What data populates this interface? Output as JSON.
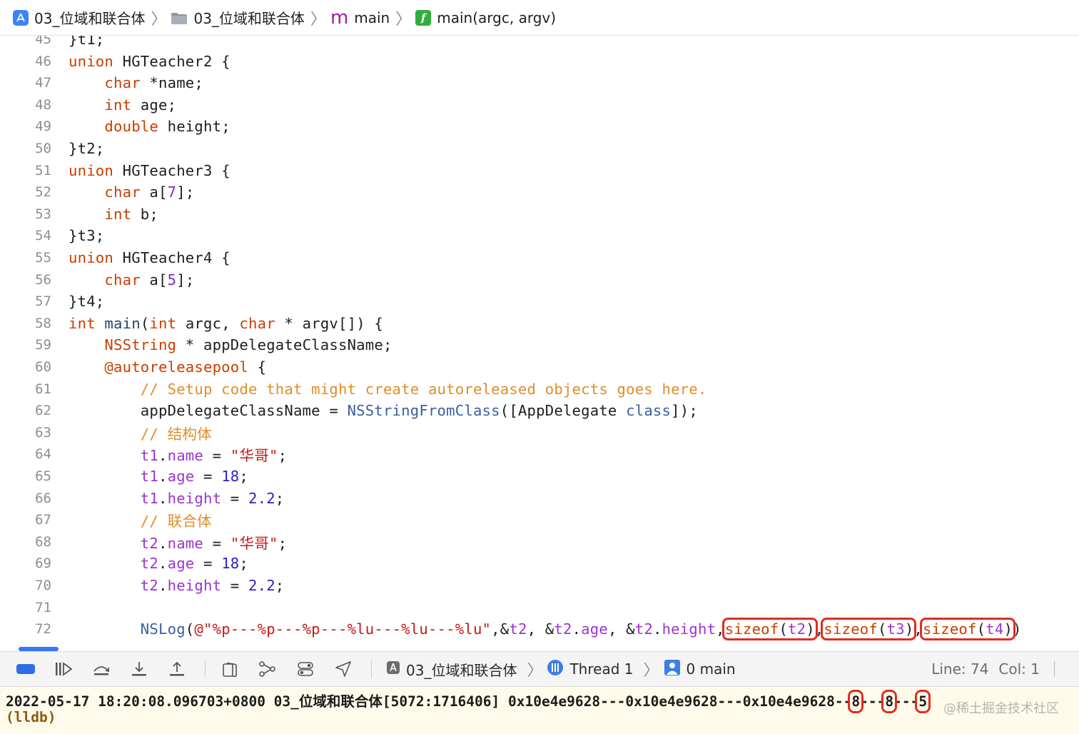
{
  "breadcrumb": {
    "project": "03_位域和联合体",
    "folder": "03_位域和联合体",
    "file": "main",
    "function": "main(argc, argv)"
  },
  "editor": {
    "lines": [
      {
        "num": "45",
        "code": "}t1;"
      },
      {
        "num": "46",
        "code": "union HGTeacher2 {"
      },
      {
        "num": "47",
        "code": "    char *name;"
      },
      {
        "num": "48",
        "code": "    int age;"
      },
      {
        "num": "49",
        "code": "    double height;"
      },
      {
        "num": "50",
        "code": "}t2;"
      },
      {
        "num": "51",
        "code": "union HGTeacher3 {"
      },
      {
        "num": "52",
        "code": "    char a[7];"
      },
      {
        "num": "53",
        "code": "    int b;"
      },
      {
        "num": "54",
        "code": "}t3;"
      },
      {
        "num": "55",
        "code": "union HGTeacher4 {"
      },
      {
        "num": "56",
        "code": "    char a[5];"
      },
      {
        "num": "57",
        "code": "}t4;"
      },
      {
        "num": "58",
        "code": "int main(int argc, char * argv[]) {"
      },
      {
        "num": "59",
        "code": "    NSString * appDelegateClassName;"
      },
      {
        "num": "60",
        "code": "    @autoreleasepool {"
      },
      {
        "num": "61",
        "code": "        // Setup code that might create autoreleased objects goes here."
      },
      {
        "num": "62",
        "code": "        appDelegateClassName = NSStringFromClass([AppDelegate class]);"
      },
      {
        "num": "63",
        "code": "        // 结构体"
      },
      {
        "num": "64",
        "code": "        t1.name = \"华哥\";"
      },
      {
        "num": "65",
        "code": "        t1.age = 18;"
      },
      {
        "num": "66",
        "code": "        t1.height = 2.2;"
      },
      {
        "num": "67",
        "code": "        // 联合体"
      },
      {
        "num": "68",
        "code": "        t2.name = \"华哥\";"
      },
      {
        "num": "69",
        "code": "        t2.age = 18;"
      },
      {
        "num": "70",
        "code": "        t2.height = 2.2;"
      },
      {
        "num": "71",
        "code": ""
      },
      {
        "num": "72",
        "code": "        NSLog(@\"%p---%p---%p---%lu---%lu---%lu\",&t2, &t2.age, &t2.height,sizeof(t2),sizeof(t3),sizeof(t4))"
      }
    ]
  },
  "debugbar": {
    "project": "03_位域和联合体",
    "thread": "Thread 1",
    "frame": "0 main",
    "line_label": "Line: 74",
    "col_label": "Col: 1"
  },
  "console": {
    "log_prefix": "2022-05-17 18:20:08.096703+0800 03_位域和联合体[5072:1716406] 0x10e4e9628---0x10e4e9628---0x10e4e9628--",
    "size_t2": "8",
    "dash_a": "---",
    "size_t3": "8",
    "dash_b": "---",
    "size_t4": "5",
    "prompt": "(lldb)",
    "watermark": "@稀土掘金技术社区"
  }
}
